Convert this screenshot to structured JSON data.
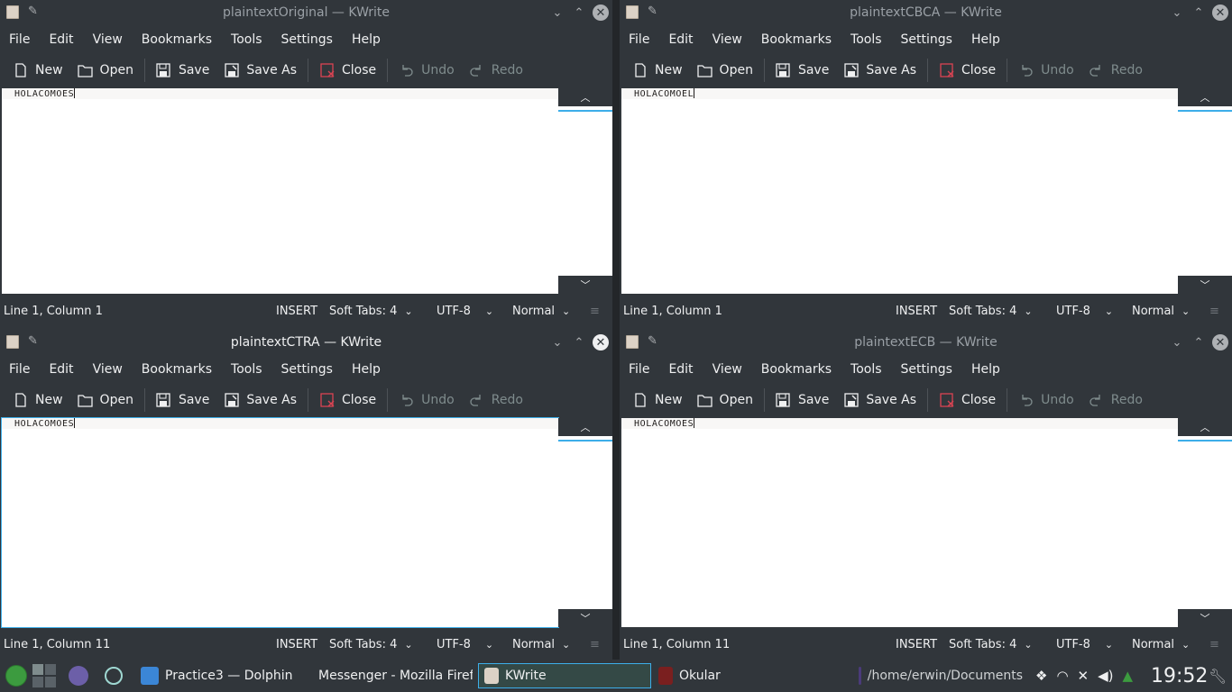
{
  "windows": [
    {
      "title": "plaintextOriginal  — KWrite",
      "menu": [
        "File",
        "Edit",
        "View",
        "Bookmarks",
        "Tools",
        "Settings",
        "Help"
      ],
      "toolbar": {
        "new": "New",
        "open": "Open",
        "save": "Save",
        "save_as": "Save As",
        "close": "Close",
        "undo": "Undo",
        "redo": "Redo"
      },
      "content": "HOLACOMOES",
      "status": {
        "position": "Line 1, Column 1",
        "mode": "INSERT",
        "indent": "Soft Tabs: 4",
        "encoding": "UTF-8",
        "highlight": "Normal"
      }
    },
    {
      "title": "plaintextCBCA  — KWrite",
      "menu": [
        "File",
        "Edit",
        "View",
        "Bookmarks",
        "Tools",
        "Settings",
        "Help"
      ],
      "toolbar": {
        "new": "New",
        "open": "Open",
        "save": "Save",
        "save_as": "Save As",
        "close": "Close",
        "undo": "Undo",
        "redo": "Redo"
      },
      "content": "HOLACOMOEL",
      "status": {
        "position": "Line 1, Column 1",
        "mode": "INSERT",
        "indent": "Soft Tabs: 4",
        "encoding": "UTF-8",
        "highlight": "Normal"
      }
    },
    {
      "title": "plaintextCTRA  — KWrite",
      "menu": [
        "File",
        "Edit",
        "View",
        "Bookmarks",
        "Tools",
        "Settings",
        "Help"
      ],
      "toolbar": {
        "new": "New",
        "open": "Open",
        "save": "Save",
        "save_as": "Save As",
        "close": "Close",
        "undo": "Undo",
        "redo": "Redo"
      },
      "content": "HOLACOMOES",
      "status": {
        "position": "Line 1, Column 11",
        "mode": "INSERT",
        "indent": "Soft Tabs: 4",
        "encoding": "UTF-8",
        "highlight": "Normal"
      }
    },
    {
      "title": "plaintextECB  — KWrite",
      "menu": [
        "File",
        "Edit",
        "View",
        "Bookmarks",
        "Tools",
        "Settings",
        "Help"
      ],
      "toolbar": {
        "new": "New",
        "open": "Open",
        "save": "Save",
        "save_as": "Save As",
        "close": "Close",
        "undo": "Undo",
        "redo": "Redo"
      },
      "content": "HOLACOMOES",
      "status": {
        "position": "Line 1, Column 11",
        "mode": "INSERT",
        "indent": "Soft Tabs: 4",
        "encoding": "UTF-8",
        "highlight": "Normal"
      }
    }
  ],
  "taskbar": {
    "tasks": [
      "Practice3 — Dolphin",
      "Messenger - Mozilla Firef",
      "KWrite",
      "Okular",
      "/home/erwin/Documents"
    ],
    "clock": "19:52"
  },
  "colors": {
    "accent": "#3daee9",
    "panel": "#31363b",
    "editor_bg": "#ffffff"
  }
}
